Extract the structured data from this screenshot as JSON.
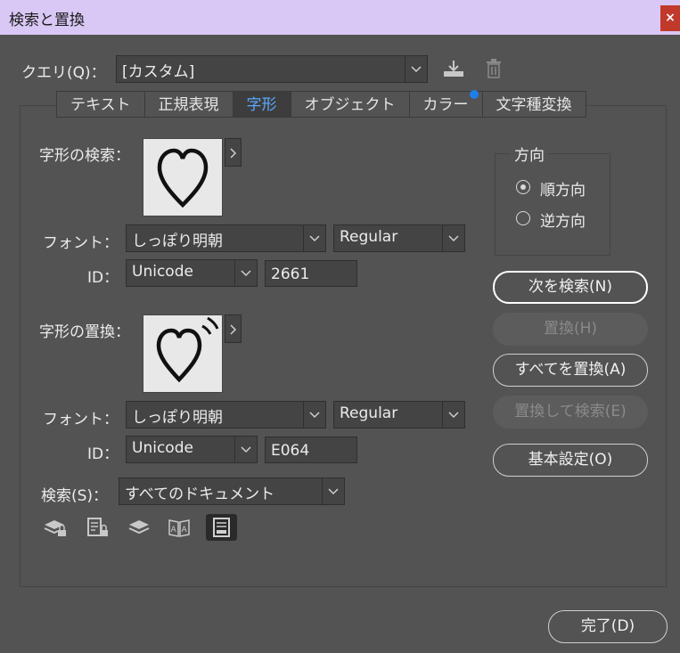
{
  "window": {
    "title": "検索と置換",
    "close_label": "×"
  },
  "query": {
    "label": "クエリ(Q)：",
    "value": "[カスタム]"
  },
  "tabs": [
    {
      "label": "テキスト",
      "active": false,
      "badge": false
    },
    {
      "label": "正規表現",
      "active": false,
      "badge": false
    },
    {
      "label": "字形",
      "active": true,
      "badge": false
    },
    {
      "label": "オブジェクト",
      "active": false,
      "badge": false
    },
    {
      "label": "カラー",
      "active": false,
      "badge": true
    },
    {
      "label": "文字種変換",
      "active": false,
      "badge": false
    }
  ],
  "find_glyph": {
    "label": "字形の検索：",
    "glyph": "♡",
    "font_label": "フォント：",
    "font": "しっぽり明朝",
    "style": "Regular",
    "id_label": "ID：",
    "id_type": "Unicode",
    "id_value": "2661"
  },
  "change_glyph": {
    "label": "字形の置換：",
    "glyph": "♡",
    "font_label": "フォント：",
    "font": "しっぽり明朝",
    "style": "Regular",
    "id_label": "ID：",
    "id_type": "Unicode",
    "id_value": "E064"
  },
  "direction": {
    "label": "方向",
    "options": [
      {
        "label": "順方向",
        "checked": true
      },
      {
        "label": "逆方向",
        "checked": false
      }
    ]
  },
  "buttons": {
    "find_next": "次を検索(N)",
    "change": "置換(H)",
    "change_all": "すべてを置換(A)",
    "change_find": "置換して検索(E)",
    "basic": "基本設定(O)",
    "done": "完了(D)"
  },
  "search": {
    "label": "検索(S)：",
    "value": "すべてのドキュメント"
  },
  "icons": {
    "save_query": "save-query-icon",
    "delete_query": "trash-icon",
    "toggles": [
      "locked-layers-icon",
      "locked-stories-icon",
      "hidden-layers-icon",
      "master-pages-icon",
      "footnotes-icon"
    ]
  },
  "colors": {
    "active_tab_text": "#5aa8ff",
    "badge": "#1f7ee8",
    "titlebar": "#d9c8f5",
    "close": "#c0392b"
  }
}
